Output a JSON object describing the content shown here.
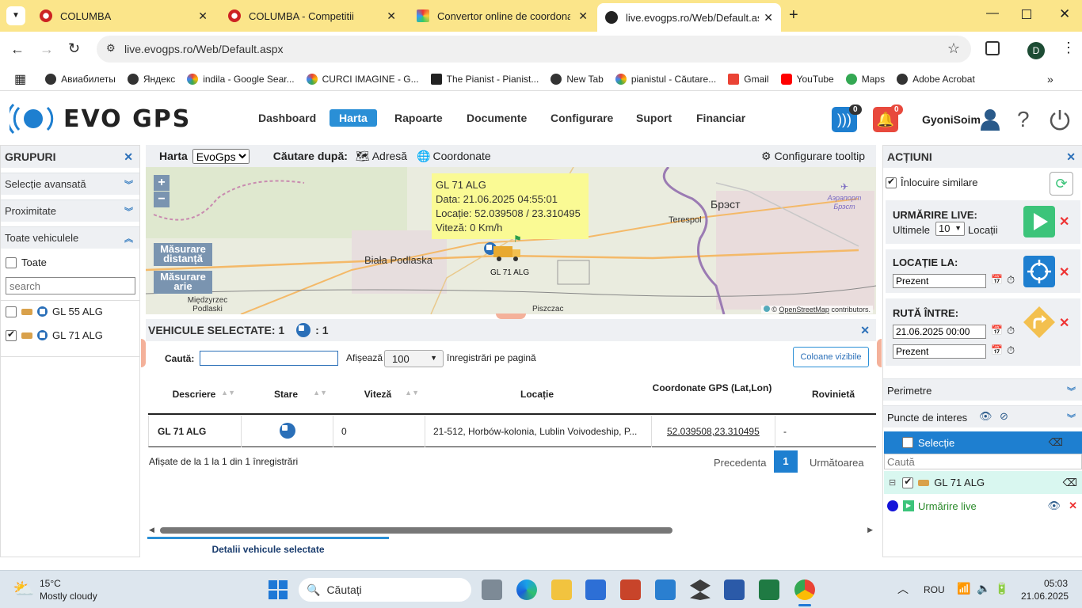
{
  "browser": {
    "tabs": [
      {
        "title": "COLUMBA",
        "active": false
      },
      {
        "title": "COLUMBA - Competitii",
        "active": false
      },
      {
        "title": "Convertor online de coordonate",
        "active": false
      },
      {
        "title": "live.evogps.ro/Web/Default.aspx",
        "active": true
      }
    ],
    "url": "live.evogps.ro/Web/Default.aspx",
    "profile_initial": "D",
    "bookmarks": [
      "Авиабилеты",
      "Яндекс",
      "indila - Google Sear...",
      "CURCI IMAGINE - G...",
      "The Pianist - Pianist...",
      "New Tab",
      "pianistul - Căutare...",
      "Gmail",
      "YouTube",
      "Maps",
      "Adobe Acrobat"
    ]
  },
  "app": {
    "logo": "EVO GPS",
    "nav": [
      "Dashboard",
      "Harta",
      "Rapoarte",
      "Documente",
      "Configurare",
      "Suport",
      "Financiar"
    ],
    "active_nav": "Harta",
    "rss_badge": "0",
    "alert_badge": "0",
    "username": "GyoniSoim"
  },
  "left": {
    "title": "GRUPURI",
    "sections": [
      "Selecție avansată",
      "Proximitate",
      "Toate vehiculele"
    ],
    "all_label": "Toate",
    "search_placeholder": "search",
    "vehicles": [
      {
        "name": "GL 55 ALG",
        "checked": false
      },
      {
        "name": "GL 71 ALG",
        "checked": true
      }
    ]
  },
  "maptoolbar": {
    "harta_label": "Harta",
    "harta_value": "EvoGps",
    "search_by": "Căutare după:",
    "adresa": "Adresă",
    "coordonate": "Coordonate",
    "tooltip_cfg": "Configurare tooltip"
  },
  "map": {
    "zoom_in": "+",
    "zoom_out": "−",
    "measure_distance": "Măsurare distanță",
    "measure_area": "Măsurare arie",
    "places": [
      "Biała Podlaska",
      "Terespol",
      "Брэст",
      "Międzyrzec Podlaski",
      "Piszczac",
      "Аэрапорт Брэст"
    ],
    "vehicle_label": "GL 71 ALG",
    "tooltip": {
      "title": "GL 71 ALG",
      "data": "Data: 21.06.2025 04:55:01",
      "locatie": "Locație: 52.039508 / 23.310495",
      "viteza": "Viteză: 0 Km/h"
    },
    "attribution_prefix": "©",
    "attribution_link": "OpenStreetMap",
    "attribution_suffix": "contributors."
  },
  "selected": {
    "title": "VEHICULE SELECTATE: 1",
    "count_badge": ": 1",
    "search_label": "Caută:",
    "show_label": "Afișează",
    "page_size": "100",
    "per_page": "înregistrări pe pagină",
    "columns_btn": "Coloane vizibile",
    "headers": [
      "Descriere",
      "Stare",
      "Viteză",
      "Locație",
      "Coordonate GPS (Lat,Lon)",
      "Rovinietă"
    ],
    "rows": [
      {
        "descriere": "GL 71 ALG",
        "viteza": "0",
        "locatie": "21-512, Horbów-kolonia, Lublin Voivodeship, P...",
        "coord": "52.039508,23.310495",
        "rovinieta": "-"
      }
    ],
    "info": "Afișate de la 1 la 1 din 1 înregistrări",
    "prev": "Precedenta",
    "page": "1",
    "next": "Următoarea",
    "tab": "Detalii vehicule selectate"
  },
  "right": {
    "title": "ACȚIUNI",
    "replace_similar": "Înlocuire similare",
    "live": {
      "title": "URMĂRIRE LIVE:",
      "last": "Ultimele",
      "count": "10",
      "unit": "Locații"
    },
    "location_at": {
      "title": "LOCAȚIE LA:",
      "value": "Prezent"
    },
    "route": {
      "title": "RUTĂ ÎNTRE:",
      "from": "21.06.2025 00:00",
      "to": "Prezent"
    },
    "perimetre": "Perimetre",
    "poi": "Puncte de interes",
    "selection": "Selecție",
    "search_placeholder": "Caută",
    "tree_vehicle": "GL 71 ALG",
    "tree_live": "Urmărire live"
  },
  "taskbar": {
    "temp": "15°C",
    "weather": "Mostly cloudy",
    "search": "Căutați",
    "lang": "ROU",
    "time": "05:03",
    "date": "21.06.2025"
  },
  "colors": {
    "accent": "#2a8fd6",
    "brand_blue": "#1e7fd0",
    "tabbar": "#fbe58a",
    "live_green": "#3cc47a",
    "route_orange": "#f3c04f"
  }
}
